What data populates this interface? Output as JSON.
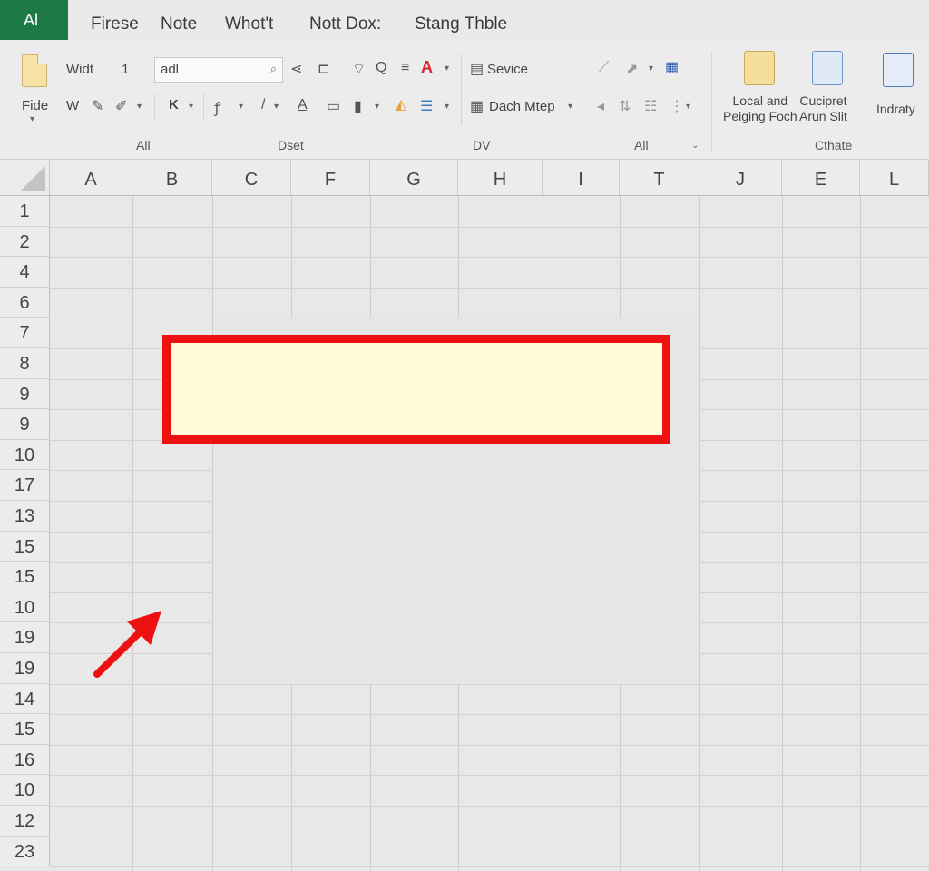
{
  "menubar": {
    "app_badge": "Al",
    "tabs": [
      "Firese",
      "Note",
      "Whot't",
      "Nott Dox:",
      "Stang Thble"
    ]
  },
  "ribbon": {
    "paste_label": "Fide",
    "width_label": "Widt",
    "width_value": "1",
    "font_box_value": "adl",
    "w_label": "W",
    "k_label": "K",
    "service_label": "Sevice",
    "dach_label": "Dach Mtep",
    "local_label_line1": "Local and",
    "local_label_line2": "Peiging Foch",
    "cuciprect_label_line1": "Cucipret",
    "cuciprect_label_line2": "Arun Slit",
    "indraty_label": "Indraty",
    "groups": [
      "All",
      "Dset",
      "DV",
      "All",
      "Cthate"
    ]
  },
  "grid": {
    "columns": [
      "A",
      "B",
      "C",
      "F",
      "G",
      "H",
      "I",
      "T",
      "J",
      "E",
      "L"
    ],
    "rows": [
      "1",
      "2",
      "4",
      "6",
      "7",
      "8",
      "9",
      "9",
      "10",
      "17",
      "13",
      "15",
      "15",
      "10",
      "19",
      "19",
      "14",
      "15",
      "16",
      "10",
      "12",
      "23"
    ]
  },
  "highlight": {
    "border_color": "#ee1111",
    "fill_color": "#fdfbd8"
  },
  "colors": {
    "app_badge": "#1e7a45",
    "font_color_a": "#d9262c"
  },
  "icons": [
    "paste-icon",
    "share-icon",
    "format-icon",
    "wifi-icon",
    "find-icon",
    "align-icon",
    "font-color-icon",
    "brush-icon",
    "pen-icon",
    "chevron-down-icon",
    "fill-color-icon",
    "arrow-pointer-icon"
  ]
}
